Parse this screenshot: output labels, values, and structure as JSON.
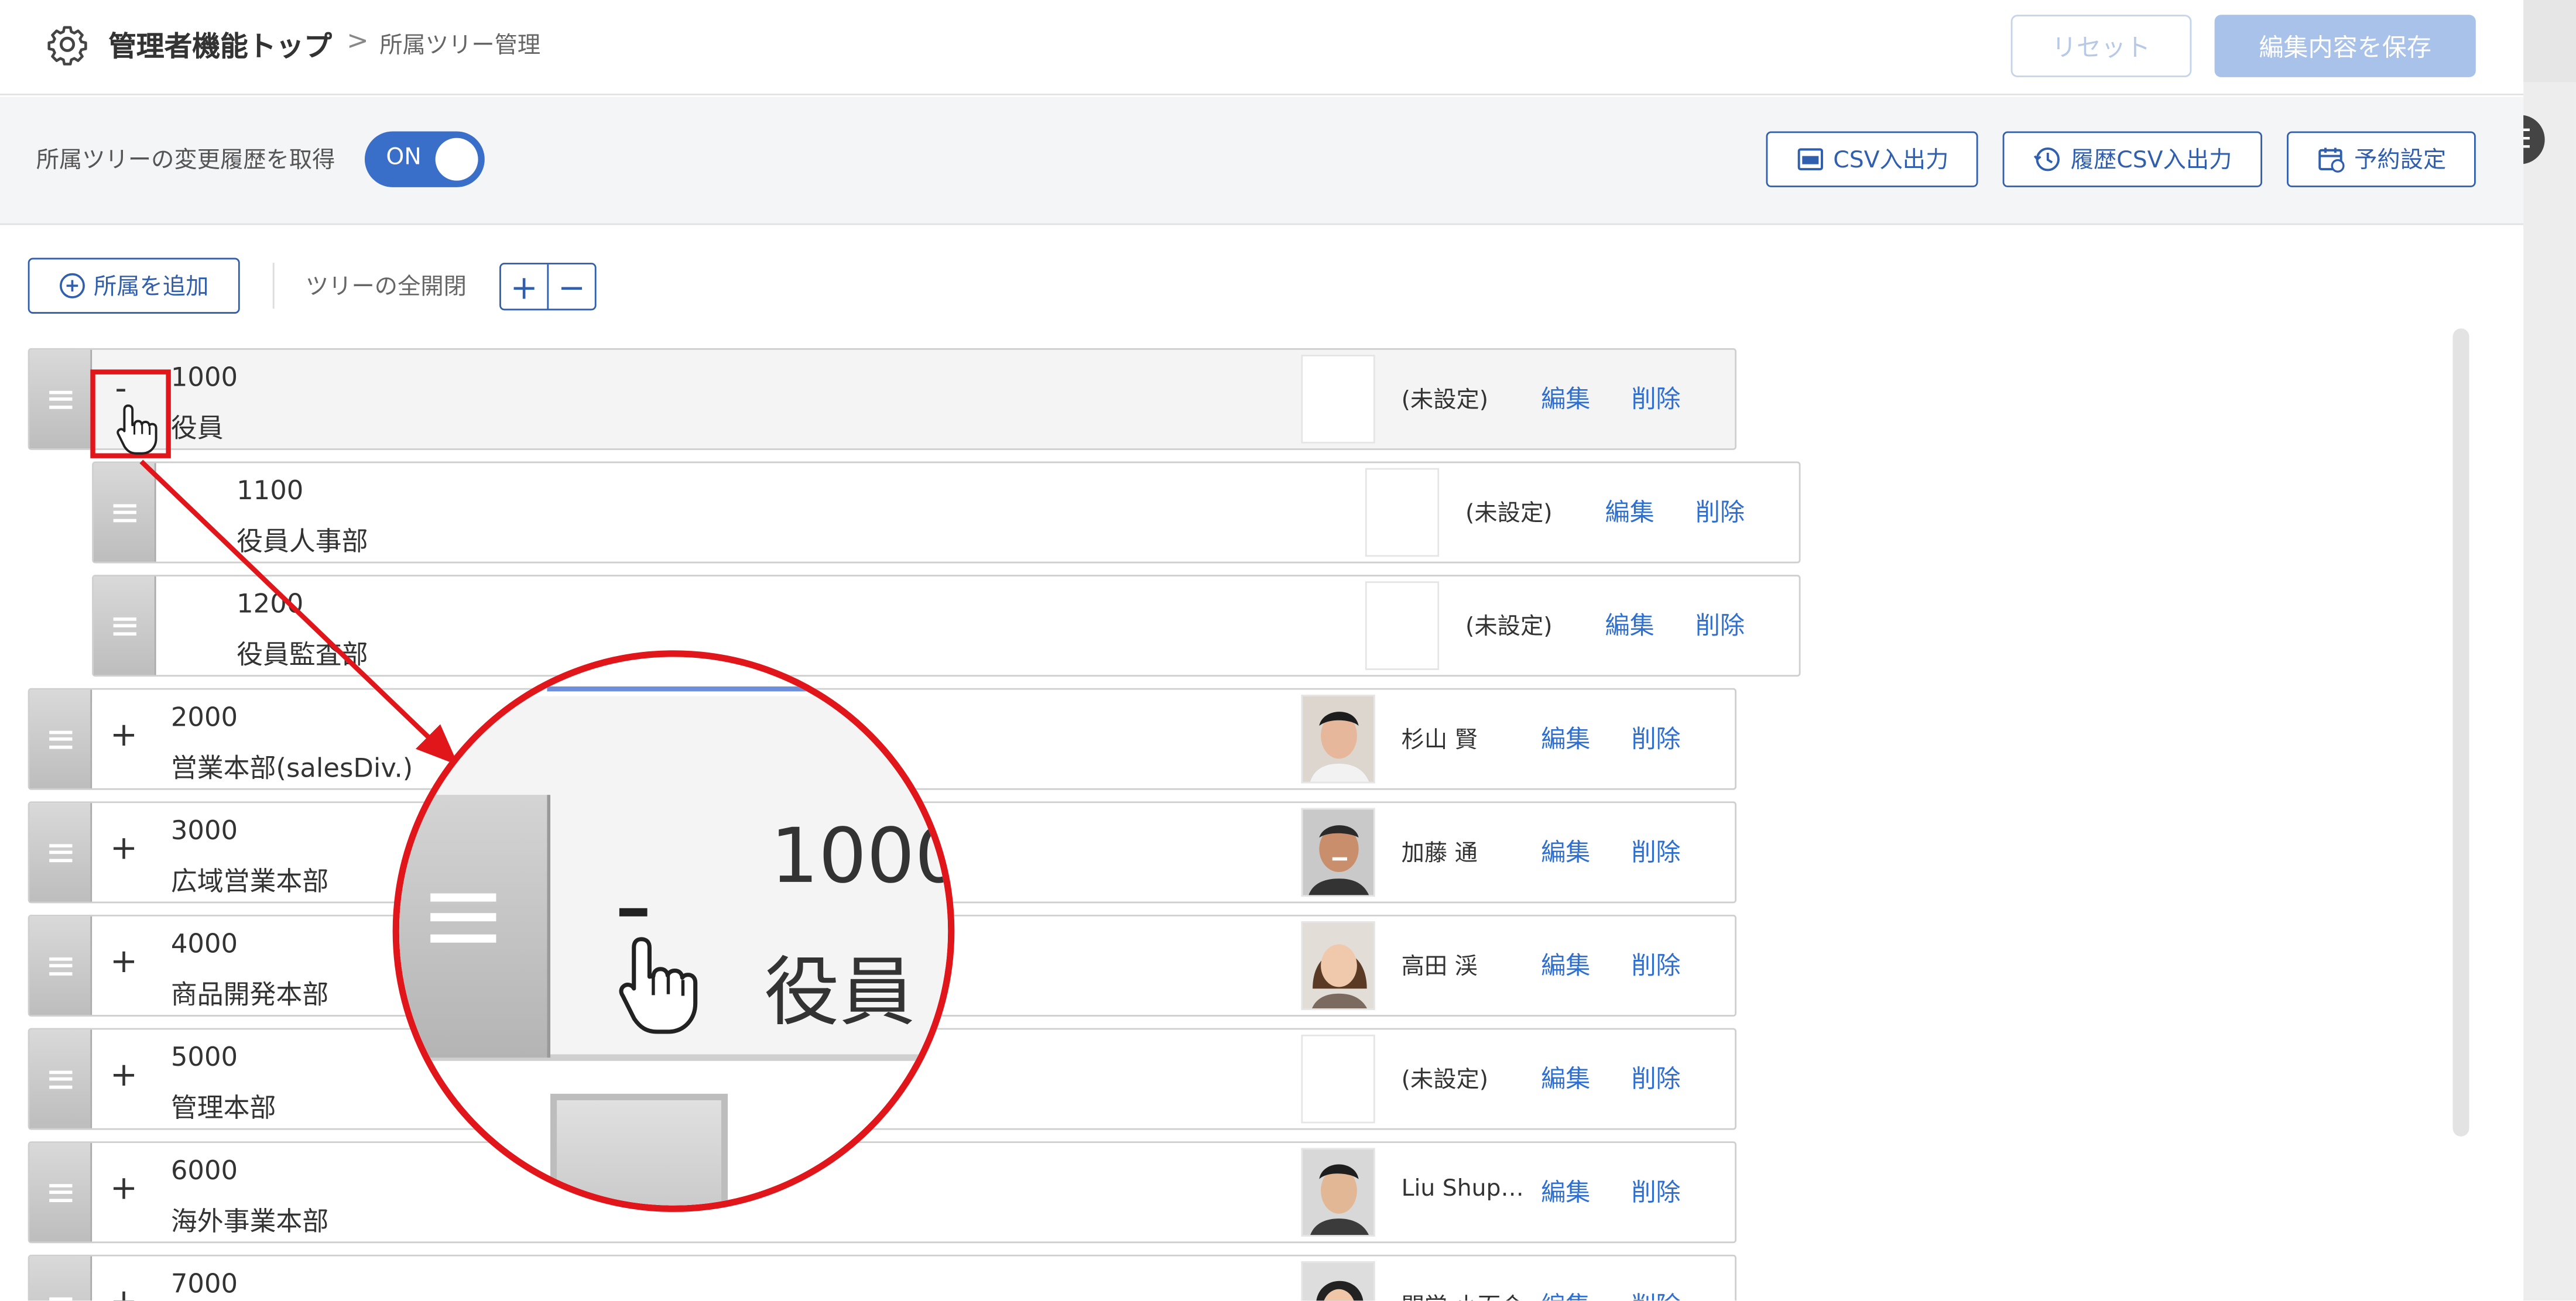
{
  "header": {
    "breadcrumb_home": "管理者機能トップ",
    "breadcrumb_sep": ">",
    "breadcrumb_current": "所属ツリー管理",
    "reset_label": "リセット",
    "save_label": "編集内容を保存"
  },
  "toolbar": {
    "history_label": "所属ツリーの変更履歴を取得",
    "toggle_label": "ON",
    "csv_label": "CSV入出力",
    "history_csv_label": "履歴CSV入出力",
    "schedule_label": "予約設定"
  },
  "actions": {
    "add_label": "所属を追加",
    "expand_label": "ツリーの全開閉",
    "plus": "+",
    "minus": "−"
  },
  "tree": {
    "rows": [
      {
        "code": "1000",
        "name": "役員",
        "person": "(未設定)",
        "edit": "編集",
        "delete": "削除",
        "toggle": "-"
      },
      {
        "code": "1100",
        "name": "役員人事部",
        "person": "(未設定)",
        "edit": "編集",
        "delete": "削除"
      },
      {
        "code": "1200",
        "name": "役員監査部",
        "person": "(未設定)",
        "edit": "編集",
        "delete": "削除"
      },
      {
        "code": "2000",
        "name": "営業本部(salesDiv.)",
        "person": "杉山 賢",
        "edit": "編集",
        "delete": "削除",
        "toggle": "+"
      },
      {
        "code": "3000",
        "name": "広域営業本部",
        "person": "加藤 通",
        "edit": "編集",
        "delete": "削除",
        "toggle": "+"
      },
      {
        "code": "4000",
        "name": "商品開発本部",
        "person": "高田 渓",
        "edit": "編集",
        "delete": "削除",
        "toggle": "+"
      },
      {
        "code": "5000",
        "name": "管理本部",
        "person": "(未設定)",
        "edit": "編集",
        "delete": "削除",
        "toggle": "+"
      },
      {
        "code": "6000",
        "name": "海外事業本部",
        "person": "Liu Shup…",
        "edit": "編集",
        "delete": "削除",
        "toggle": "+"
      },
      {
        "code": "7000",
        "name": "",
        "person": "関学 小百合",
        "edit": "編集",
        "delete": "削除",
        "toggle": "+"
      }
    ]
  },
  "zoom": {
    "code": "1000",
    "name": "役員"
  },
  "colors": {
    "accent": "#2f5fae",
    "annotation": "#e0161b",
    "link": "#2f6fd0"
  }
}
